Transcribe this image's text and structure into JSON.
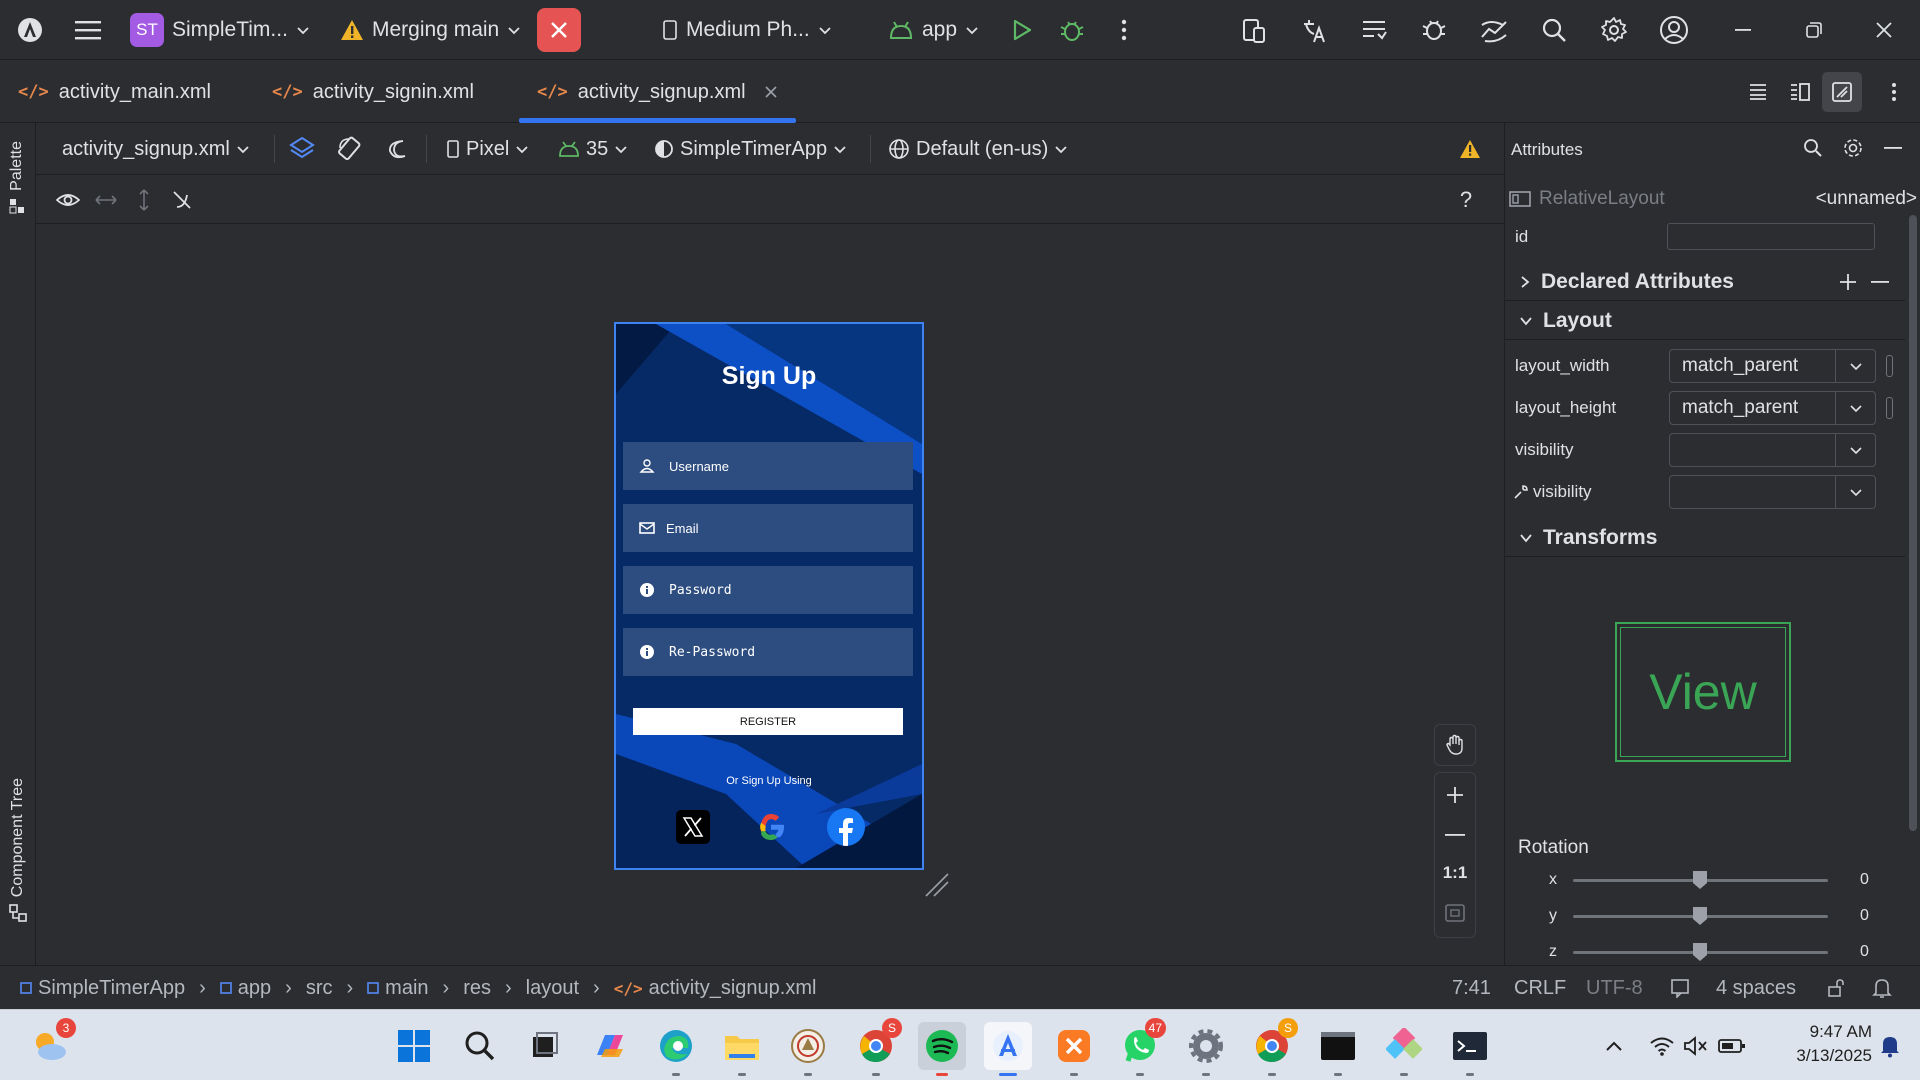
{
  "titlebar": {
    "project_badge": "ST",
    "project_name": "SimpleTim...",
    "vcs_branch": "Merging main",
    "device": "Medium Ph...",
    "run_config": "app"
  },
  "tabs": [
    {
      "label": "activity_main.xml"
    },
    {
      "label": "activity_signin.xml"
    },
    {
      "label": "activity_signup.xml"
    }
  ],
  "left_strip": {
    "palette": "Palette",
    "component_tree": "Component Tree"
  },
  "design_toolbar": {
    "file": "activity_signup.xml",
    "device": "Pixel",
    "api": "35",
    "theme": "SimpleTimerApp",
    "locale": "Default (en-us)"
  },
  "phone": {
    "title": "Sign Up",
    "fields": {
      "username": "Username",
      "email": "Email",
      "password": "Password",
      "repassword": "Re-Password"
    },
    "register": "REGISTER",
    "or_text": "Or Sign Up Using"
  },
  "zoom": {
    "one_to_one": "1:1"
  },
  "attributes": {
    "header": "Attributes",
    "component_type": "RelativeLayout",
    "component_name": "<unnamed>",
    "id_label": "id",
    "id_value": "",
    "declared_section": "Declared Attributes",
    "layout_section": "Layout",
    "layout_width_label": "layout_width",
    "layout_width_value": "match_parent",
    "layout_height_label": "layout_height",
    "layout_height_value": "match_parent",
    "visibility_label": "visibility",
    "visibility_value": "",
    "tools_visibility_label": "visibility",
    "tools_visibility_value": "",
    "transforms_section": "Transforms",
    "view_preview": "View",
    "rotation_label": "Rotation",
    "rotation": [
      {
        "axis": "x",
        "value": "0"
      },
      {
        "axis": "y",
        "value": "0"
      },
      {
        "axis": "z",
        "value": "0"
      }
    ]
  },
  "statusbar": {
    "crumbs": [
      "SimpleTimerApp",
      "app",
      "src",
      "main",
      "res",
      "layout",
      "activity_signup.xml"
    ],
    "position": "7:41",
    "line_sep": "CRLF",
    "encoding": "UTF-8",
    "indent": "4 spaces"
  },
  "taskbar": {
    "weather_badge": "3",
    "chrome_badge": "S",
    "whatsapp_badge": "47",
    "chrome2_badge": "S",
    "time": "9:47 AM",
    "date": "3/13/2025"
  },
  "colors": {
    "accent": "#3574f0",
    "phone_bg": "#062a66",
    "field_bg": "#2d4d80",
    "warning": "#f0b429",
    "run_green": "#5fb865"
  }
}
